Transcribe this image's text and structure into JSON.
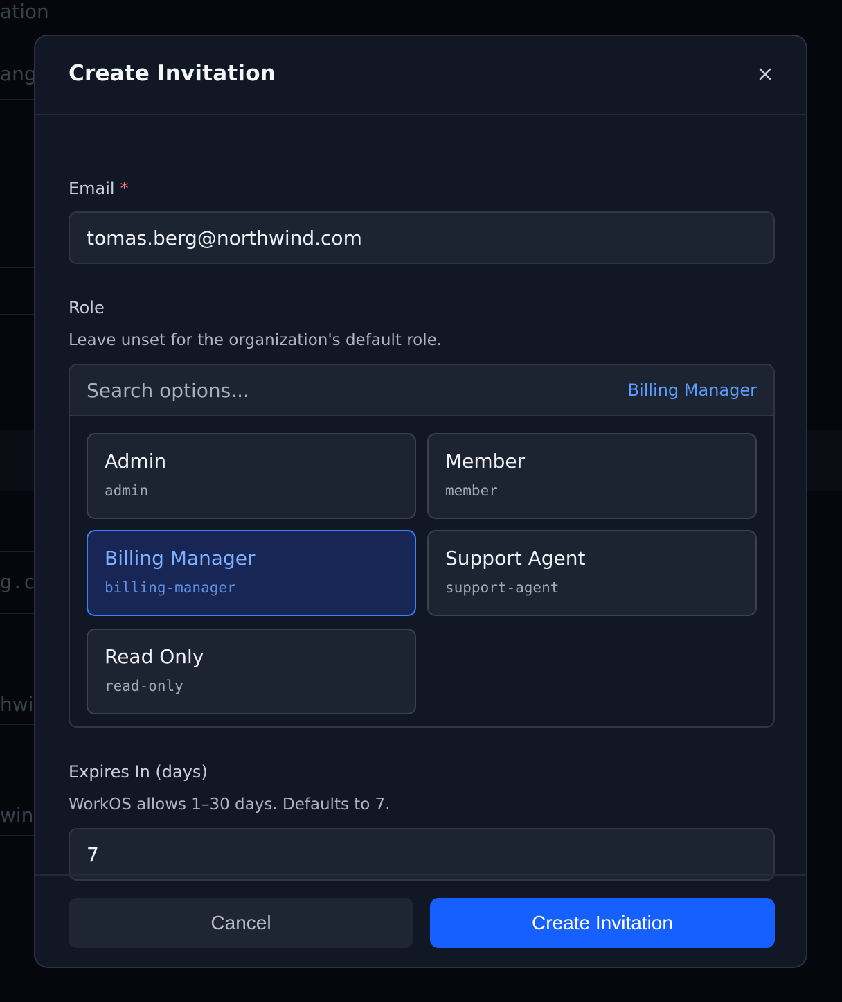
{
  "background": {
    "fragments": [
      "ation",
      "ange",
      "g.c",
      "hwin",
      "win"
    ]
  },
  "modal": {
    "title": "Create Invitation",
    "close_icon": "close-icon",
    "email": {
      "label": "Email",
      "required_marker": "*",
      "value": "tomas.berg@northwind.com"
    },
    "role": {
      "label": "Role",
      "helper": "Leave unset for the organization's default role.",
      "search_placeholder": "Search options...",
      "selected_label": "Billing Manager",
      "options": [
        {
          "name": "Admin",
          "slug": "admin",
          "selected": false
        },
        {
          "name": "Member",
          "slug": "member",
          "selected": false
        },
        {
          "name": "Billing Manager",
          "slug": "billing-manager",
          "selected": true
        },
        {
          "name": "Support Agent",
          "slug": "support-agent",
          "selected": false
        },
        {
          "name": "Read Only",
          "slug": "read-only",
          "selected": false
        }
      ]
    },
    "expires": {
      "label": "Expires In (days)",
      "helper": "WorkOS allows 1–30 days. Defaults to 7.",
      "value": "7"
    },
    "footer": {
      "cancel_label": "Cancel",
      "submit_label": "Create Invitation"
    }
  },
  "colors": {
    "accent": "#1660ff",
    "selected_border": "#3b82f6",
    "selected_text": "#7fb0ff",
    "required": "#f0727a"
  }
}
